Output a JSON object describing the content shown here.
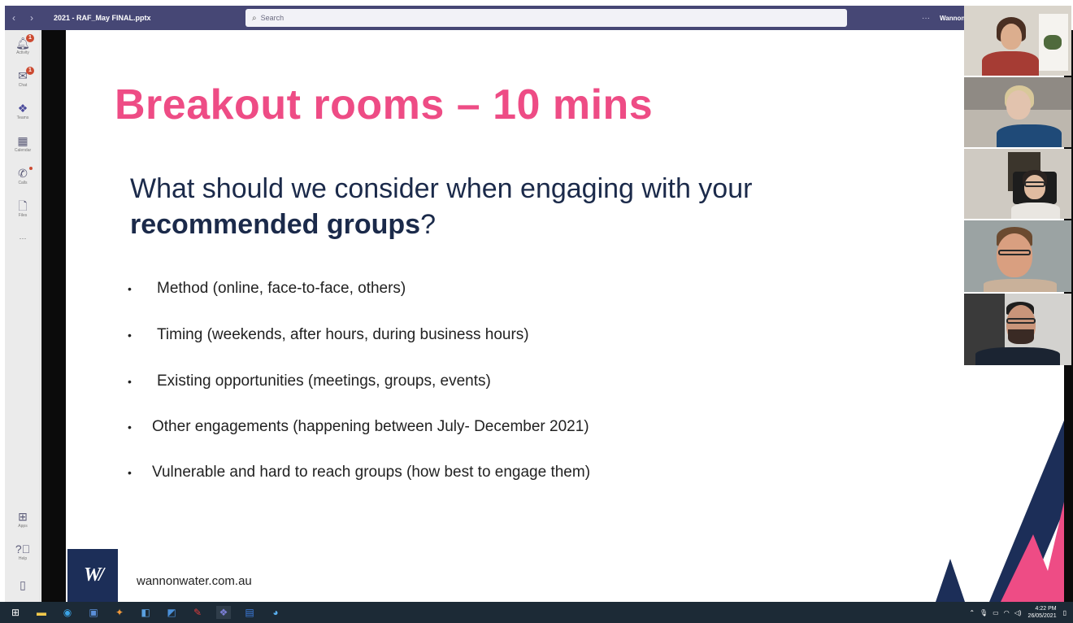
{
  "titlebar": {
    "back": "‹",
    "forward": "›",
    "document_title": "2021 - RAF_May FINAL.pptx",
    "search_placeholder": "Search",
    "more": "···",
    "tenant": "Wannon"
  },
  "rail": {
    "items": [
      {
        "label": "Activity",
        "icon": "bell-icon",
        "badge": "1"
      },
      {
        "label": "Chat",
        "icon": "chat-icon",
        "badge": "1"
      },
      {
        "label": "Teams",
        "icon": "teams-icon"
      },
      {
        "label": "Calendar",
        "icon": "calendar-icon"
      },
      {
        "label": "Calls",
        "icon": "phone-icon"
      },
      {
        "label": "Files",
        "icon": "file-icon"
      },
      {
        "label": "···",
        "icon": "more-icon"
      },
      {
        "label": "Apps",
        "icon": "apps-icon"
      },
      {
        "label": "Help",
        "icon": "help-icon"
      }
    ]
  },
  "slide": {
    "title": "Breakout rooms – 10 mins",
    "question_prefix": "What should we consider when engaging with your",
    "question_bold": "recommended groups",
    "question_suffix": "?",
    "bullets": [
      "Method (online, face-to-face, others)",
      "Timing (weekends, after hours, during business hours)",
      "Existing opportunities (meetings, groups, events)",
      "Other engagements (happening between July- December 2021)",
      "Vulnerable and hard to reach groups (how best to engage them)"
    ],
    "bullet_glyph": "•",
    "logo_text": "W/",
    "website": "wannonwater.com.au",
    "colors": {
      "title": "#ee4c85",
      "navy": "#1c2e58"
    }
  },
  "taskbar": {
    "time": "4:22 PM",
    "date": "26/05/2021"
  }
}
